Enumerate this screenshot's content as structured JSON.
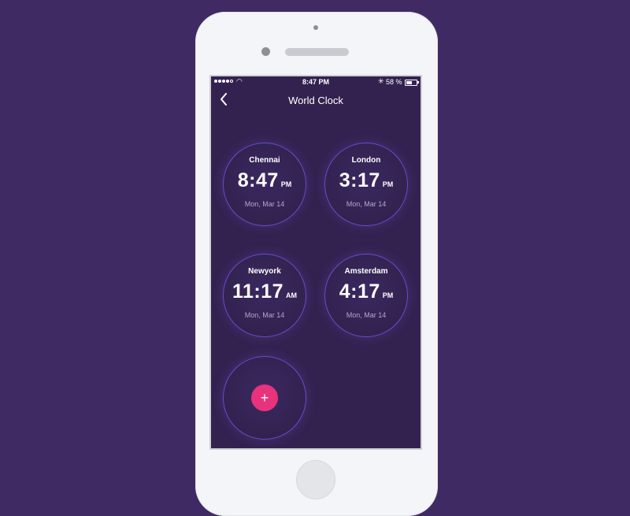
{
  "status_bar": {
    "time": "8:47 PM",
    "battery": "58 %"
  },
  "nav": {
    "title": "World Clock"
  },
  "clocks": [
    {
      "city": "Chennai",
      "time": "8:47",
      "ampm": "PM",
      "date": "Mon, Mar 14"
    },
    {
      "city": "London",
      "time": "3:17",
      "ampm": "PM",
      "date": "Mon, Mar 14"
    },
    {
      "city": "Newyork",
      "time": "11:17",
      "ampm": "AM",
      "date": "Mon, Mar 14"
    },
    {
      "city": "Amsterdam",
      "time": "4:17",
      "ampm": "PM",
      "date": "Mon, Mar 14"
    }
  ],
  "add_button": {
    "label": "+"
  },
  "colors": {
    "background": "#3f2a63",
    "screen": "#332250",
    "ring": "#6a4bc9",
    "accent": "#e8327c"
  }
}
